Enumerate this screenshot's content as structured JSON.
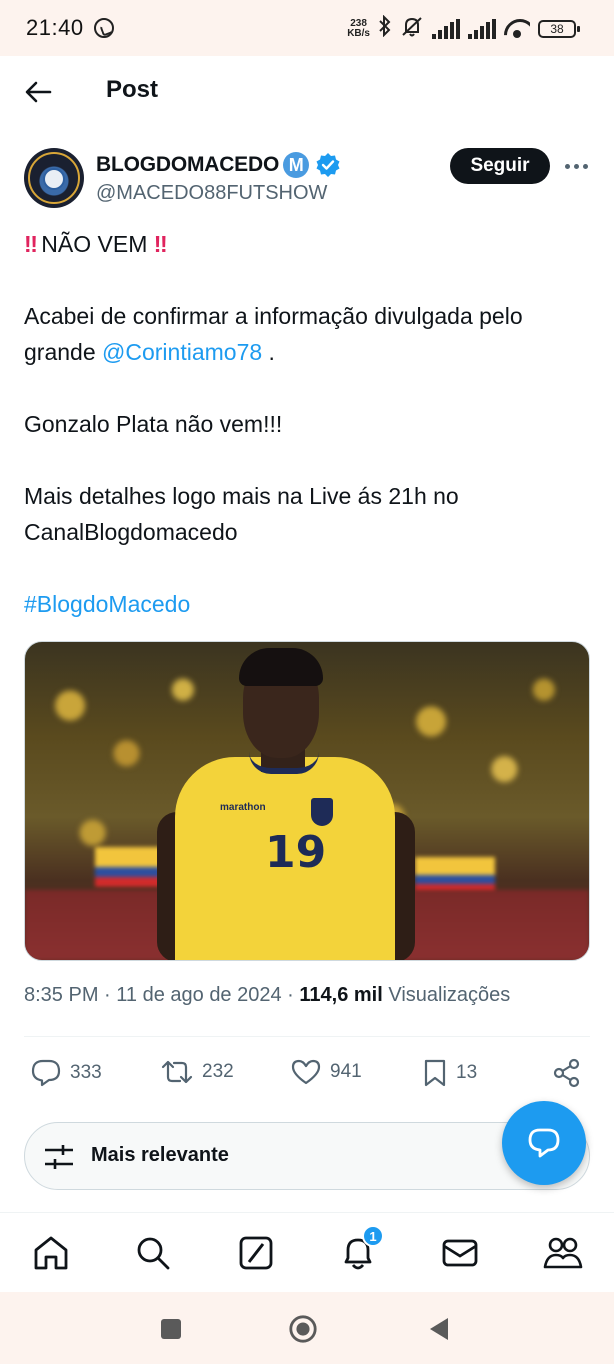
{
  "status_bar": {
    "time": "21:40",
    "speed_value": "238",
    "speed_unit": "KB/s",
    "battery": "38",
    "icons": [
      "whatsapp-icon",
      "bluetooth-icon",
      "mute-icon",
      "signal-icon",
      "signal-icon",
      "wifi-icon",
      "battery-icon"
    ]
  },
  "header": {
    "title": "Post"
  },
  "author": {
    "name": "BLOGDOMACEDO",
    "badge_letter": "M",
    "handle": "@MACEDO88FUTSHOW",
    "follow_label": "Seguir",
    "verified_color": "#1d9bf0"
  },
  "tweet": {
    "headline_marks": "‼",
    "headline_text": "NÃO VEM",
    "line1": "Acabei de confirmar a informação divulgada pelo grande",
    "mention": "@Corintiamo78",
    "line1_end": ".",
    "line2": "Gonzalo Plata não vem!!!",
    "line3": "Mais detalhes logo mais na Live ás 21h no CanalBlogdomacedo",
    "hashtag": "#BlogdoMacedo"
  },
  "media": {
    "jersey_sponsor": "marathon",
    "jersey_number": "19"
  },
  "meta": {
    "time": "8:35 PM",
    "date": "11 de ago de 2024",
    "views": "114,6 mil",
    "views_label": "Visualizações"
  },
  "actions": {
    "replies": "333",
    "reposts": "232",
    "likes": "941",
    "bookmarks": "13"
  },
  "sort": {
    "label": "Mais relevante"
  },
  "nav": {
    "notifications_count": "1"
  },
  "colors": {
    "accent": "#1d9bf0",
    "text": "#0f1419",
    "secondary": "#536471",
    "system_bar": "#fdf3ee"
  }
}
